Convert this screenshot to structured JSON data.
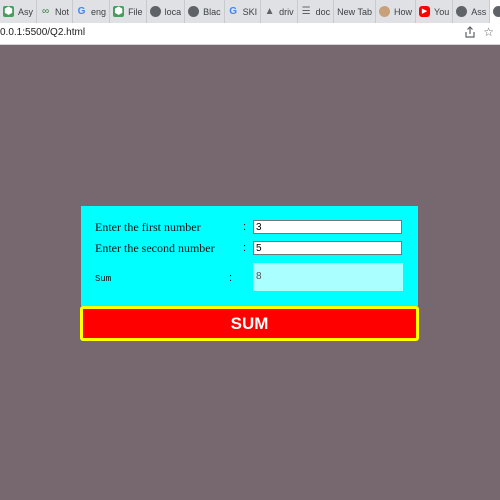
{
  "browser": {
    "tabs": [
      {
        "icon": "gear-icon",
        "label": "Asy",
        "icon_color": "#4a9e5c"
      },
      {
        "icon": "infinity-icon",
        "label": "Not",
        "icon_color": "#2e7d32"
      },
      {
        "icon": "google-icon",
        "label": "eng",
        "icon_color": "#4285f4"
      },
      {
        "icon": "gear-icon",
        "label": "File",
        "icon_color": "#4a9e5c"
      },
      {
        "icon": "globe-icon",
        "label": "loca",
        "icon_color": "#5f6368"
      },
      {
        "icon": "globe-icon",
        "label": "Blac",
        "icon_color": "#5f6368"
      },
      {
        "icon": "google-icon",
        "label": "SKI",
        "icon_color": "#4285f4"
      },
      {
        "icon": "drive-icon",
        "label": "driv",
        "icon_color": "#5f6368"
      },
      {
        "icon": "doc-icon",
        "label": "doc",
        "icon_color": "#5f6368"
      },
      {
        "icon": "",
        "label": "New Tab",
        "icon_color": ""
      },
      {
        "icon": "avatar-icon",
        "label": "How",
        "icon_color": "#c8a07a"
      },
      {
        "icon": "youtube-icon",
        "label": "You",
        "icon_color": "#ff0000"
      },
      {
        "icon": "globe-icon",
        "label": "Ass",
        "icon_color": "#5f6368"
      },
      {
        "icon": "globe-icon",
        "label": "",
        "icon_color": "#5f6368"
      }
    ],
    "tab_close": "×",
    "url": "0.0.1:5500/Q2.html",
    "star": "☆"
  },
  "form": {
    "first_label": "Enter the first number",
    "second_label": "Enter the second number",
    "sum_label": "Sum",
    "colon": ":",
    "first_value": "3",
    "second_value": "5",
    "sum_value": "8",
    "button_label": "SUM"
  },
  "colors": {
    "page_background": "#77686f",
    "form_background": "#00ffff",
    "sum_output_background": "#aaffff",
    "button_background": "#ff0000",
    "button_border": "#ffff00"
  }
}
